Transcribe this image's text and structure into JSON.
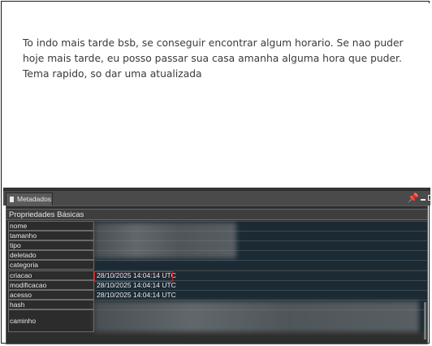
{
  "message": {
    "text": "To indo mais tarde bsb, se conseguir encontrar algum horario. Se nao puder hoje mais tarde, eu posso passar sua casa amanha alguma hora que puder. Tema rapido, so dar uma atualizada"
  },
  "panel": {
    "tab_label": "Metadados",
    "section_title": "Propriedades Básicas"
  },
  "properties": [
    {
      "key": "nome",
      "value": ""
    },
    {
      "key": "tamanho",
      "value": ""
    },
    {
      "key": "tipo",
      "value": ""
    },
    {
      "key": "deletado",
      "value": ""
    },
    {
      "key": "categoria",
      "value": ""
    },
    {
      "key": "criacao",
      "value": "28/10/2025 14:04:14 UTC"
    },
    {
      "key": "modificacao",
      "value": "28/10/2025 14:04:14 UTC"
    },
    {
      "key": "acesso",
      "value": "28/10/2025 14:04:14 UTC"
    },
    {
      "key": "hash",
      "value": ""
    },
    {
      "key": "caminho",
      "value": ""
    }
  ],
  "icons": [
    "document-icon",
    "pin-icon",
    "minimize-icon",
    "maximize-icon"
  ],
  "colors": {
    "highlight": "#d21e1e",
    "panel_bg": "#2e2e2e"
  }
}
